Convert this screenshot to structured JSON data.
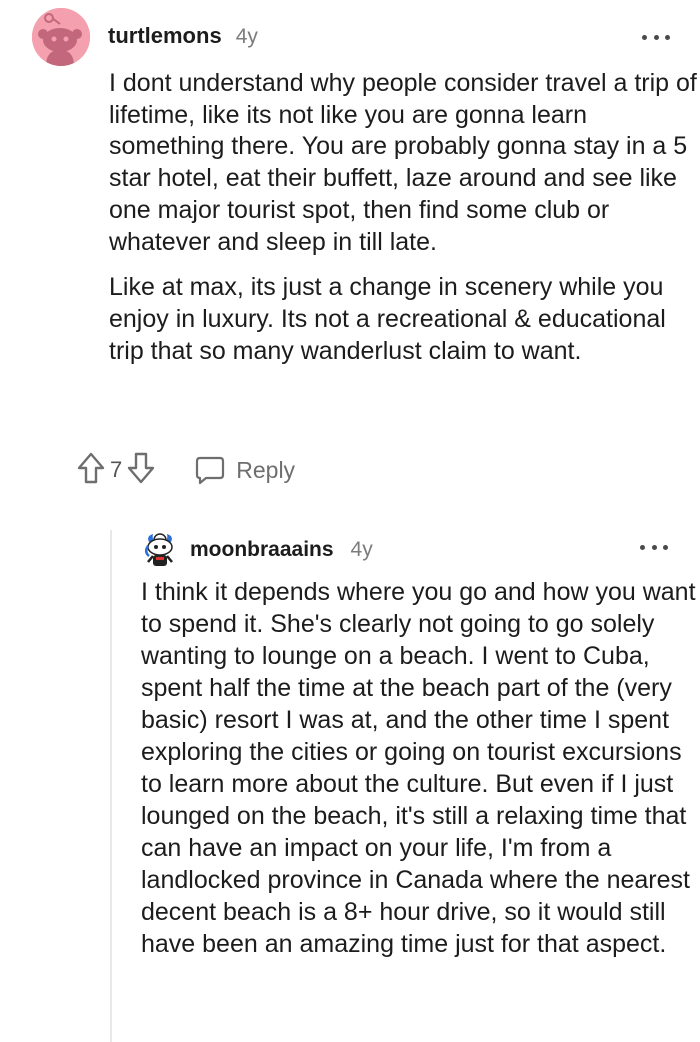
{
  "comments": [
    {
      "username": "turtlemons",
      "age": "4y",
      "avatar_icon": "reddit-snoo-avatar-pink",
      "paragraphs": [
        "I dont understand why people consider travel a trip of lifetime, like its not like you are gonna learn something there. You are probably gonna stay in a 5 star hotel, eat their buffett, laze around and see like one major tourist spot, then find some club or whatever and sleep in till late.",
        "Like at max, its just a change in scenery while you enjoy in luxury. Its not a recreational & educational trip that so many wanderlust claim to want."
      ],
      "votes": "7",
      "reply_label": "Reply"
    },
    {
      "username": "moonbraaains",
      "age": "4y",
      "avatar_icon": "reddit-snoo-avatar-custom",
      "paragraphs": [
        "I think it depends where you go and how you want to spend it. She's clearly not going to go solely wanting to lounge on a beach. I went to Cuba, spent half the time at the beach part of the (very basic) resort I was at, and the other time I spent exploring the cities or going on tourist excursions to learn more about the culture. But even if I just lounged on the beach, it's still a relaxing time that can have an impact on your life, I'm from a landlocked province in Canada where the nearest decent beach is a 8+ hour drive, so it would still have been an amazing time just for that aspect."
      ]
    }
  ],
  "icons": {
    "upvote": "upvote-arrow-icon",
    "downvote": "downvote-arrow-icon",
    "reply": "speech-bubble-icon",
    "more": "more-options-icon"
  },
  "colors": {
    "avatar_pink": "#f4a0ae",
    "text": "#1c1c1c",
    "muted": "#7c7c7c",
    "thread_line": "#e8e8e8"
  }
}
